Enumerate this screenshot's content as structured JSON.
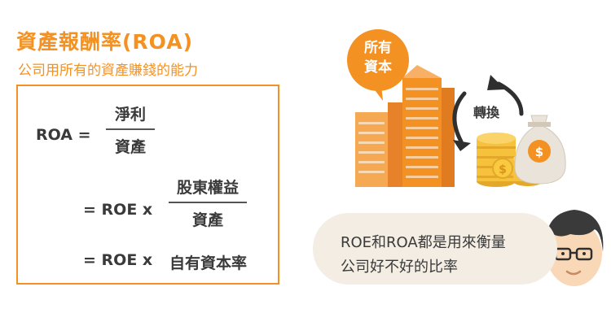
{
  "header": {
    "title": "資產報酬率(ROA)",
    "subtitle": "公司用所有的資產賺錢的能力"
  },
  "formula": {
    "lhs": "ROA =",
    "line1": {
      "numerator": "淨利",
      "denominator": "資產"
    },
    "line2": {
      "prefix": "=   ROE x",
      "numerator": "股東權益",
      "denominator": "資產"
    },
    "line3": {
      "prefix": "=   ROE x",
      "term": "自有資本率"
    }
  },
  "illustration": {
    "assets_bubble": [
      "所有",
      "資本"
    ],
    "exchange_label": "轉換",
    "money_bag_symbol": "$",
    "colors": {
      "accent": "#f39223",
      "gold": "#f6c23b",
      "bag": "#e9e3da"
    }
  },
  "speech": {
    "lines": [
      "ROE和ROA都是用來衡量",
      "公司好不好的比率"
    ]
  }
}
